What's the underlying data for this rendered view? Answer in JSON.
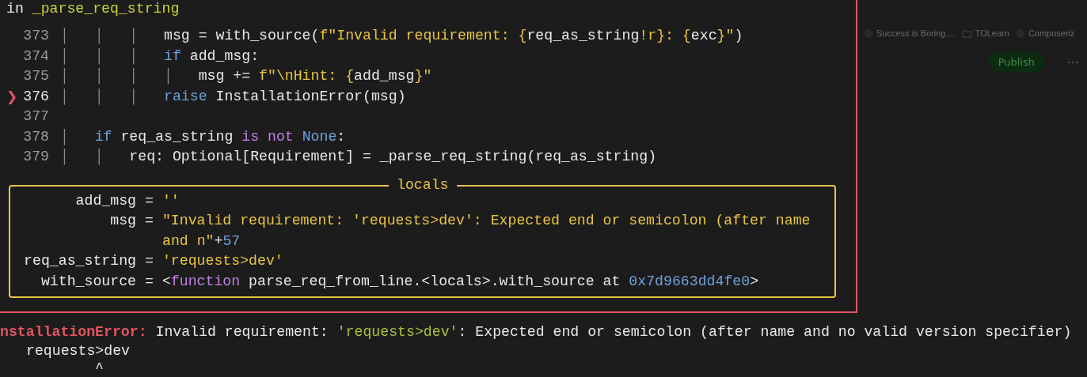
{
  "browser": {
    "bookmarks": [
      {
        "kind": "site",
        "label": "Success is Boring...."
      },
      {
        "kind": "folder",
        "label": "TOLearn"
      },
      {
        "kind": "site",
        "label": "Composeriz"
      }
    ],
    "editor_header": {
      "publish": "Publish",
      "more": "⋯"
    }
  },
  "traceback": {
    "frame": {
      "prefix": "in",
      "function": "_parse_req_string"
    },
    "marker": "❯",
    "lines": [
      {
        "number": "373",
        "current": false,
        "tokens": [
          {
            "kind": "guide",
            "text": "│   │   │   "
          },
          {
            "kind": "plain",
            "text": "msg = with_source("
          },
          {
            "kind": "string",
            "text": "f\"Invalid requirement: {"
          },
          {
            "kind": "plain",
            "text": "req_as_string"
          },
          {
            "kind": "string",
            "text": "!r}: {"
          },
          {
            "kind": "plain",
            "text": "exc"
          },
          {
            "kind": "string",
            "text": "}\""
          },
          {
            "kind": "plain",
            "text": ")"
          }
        ]
      },
      {
        "number": "374",
        "current": false,
        "tokens": [
          {
            "kind": "guide",
            "text": "│   │   │   "
          },
          {
            "kind": "keyword",
            "text": "if"
          },
          {
            "kind": "plain",
            "text": " add_msg:"
          }
        ]
      },
      {
        "number": "375",
        "current": false,
        "tokens": [
          {
            "kind": "guide",
            "text": "│   │   │   │   "
          },
          {
            "kind": "plain",
            "text": "msg += "
          },
          {
            "kind": "string",
            "text": "f\"\\nHint: {"
          },
          {
            "kind": "plain",
            "text": "add_msg"
          },
          {
            "kind": "string",
            "text": "}\""
          }
        ]
      },
      {
        "number": "376",
        "current": true,
        "tokens": [
          {
            "kind": "guide",
            "text": "│   │   │   "
          },
          {
            "kind": "keyword",
            "text": "raise"
          },
          {
            "kind": "plain",
            "text": " InstallationError(msg)"
          }
        ]
      },
      {
        "number": "377",
        "current": false
      },
      {
        "number": "378",
        "current": false,
        "tokens": [
          {
            "kind": "guide",
            "text": "│   "
          },
          {
            "kind": "keyword",
            "text": "if"
          },
          {
            "kind": "plain",
            "text": " req_as_string "
          },
          {
            "kind": "operator",
            "text": "is not"
          },
          {
            "kind": "keyword",
            "text": " None"
          },
          {
            "kind": "plain",
            "text": ":"
          }
        ]
      },
      {
        "number": "379",
        "current": false,
        "tokens": [
          {
            "kind": "guide",
            "text": "│   │   "
          },
          {
            "kind": "plain",
            "text": "req: Optional[Requirement] = _parse_req_string(req_as_string)"
          }
        ]
      }
    ],
    "locals": {
      "title": "locals",
      "entries": [
        {
          "name": "add_msg",
          "separator": "=",
          "lines": [
            [
              {
                "kind": "string",
                "text": "''"
              }
            ]
          ]
        },
        {
          "name": "msg",
          "separator": "=",
          "lines": [
            [
              {
                "kind": "string",
                "text": "\"Invalid requirement: 'requests>dev': Expected end or semicolon (after name"
              }
            ],
            [
              {
                "kind": "string",
                "text": "and n\""
              },
              {
                "kind": "plain",
                "text": "+"
              },
              {
                "kind": "number",
                "text": "57"
              }
            ]
          ]
        },
        {
          "name": "req_as_string",
          "separator": "=",
          "lines": [
            [
              {
                "kind": "string",
                "text": "'requests>dev'"
              }
            ]
          ]
        },
        {
          "name": "with_source",
          "separator": "=",
          "lines": [
            [
              {
                "kind": "plain",
                "text": "<"
              },
              {
                "kind": "operator",
                "text": "function"
              },
              {
                "kind": "plain",
                "text": " parse_req_from_line.<locals>.with_source at "
              },
              {
                "kind": "number",
                "text": "0x7d9663dd4fe0"
              },
              {
                "kind": "plain",
                "text": ">"
              }
            ]
          ]
        }
      ]
    },
    "error": {
      "type": "nstallationError:",
      "message": [
        {
          "kind": "plain",
          "text": " Invalid requirement: "
        },
        {
          "kind": "quoted",
          "text": "'requests>dev'"
        },
        {
          "kind": "plain",
          "text": ": Expected end or semicolon (after name and no valid version specifier)"
        }
      ],
      "source": "requests>dev",
      "caret": "^"
    }
  }
}
